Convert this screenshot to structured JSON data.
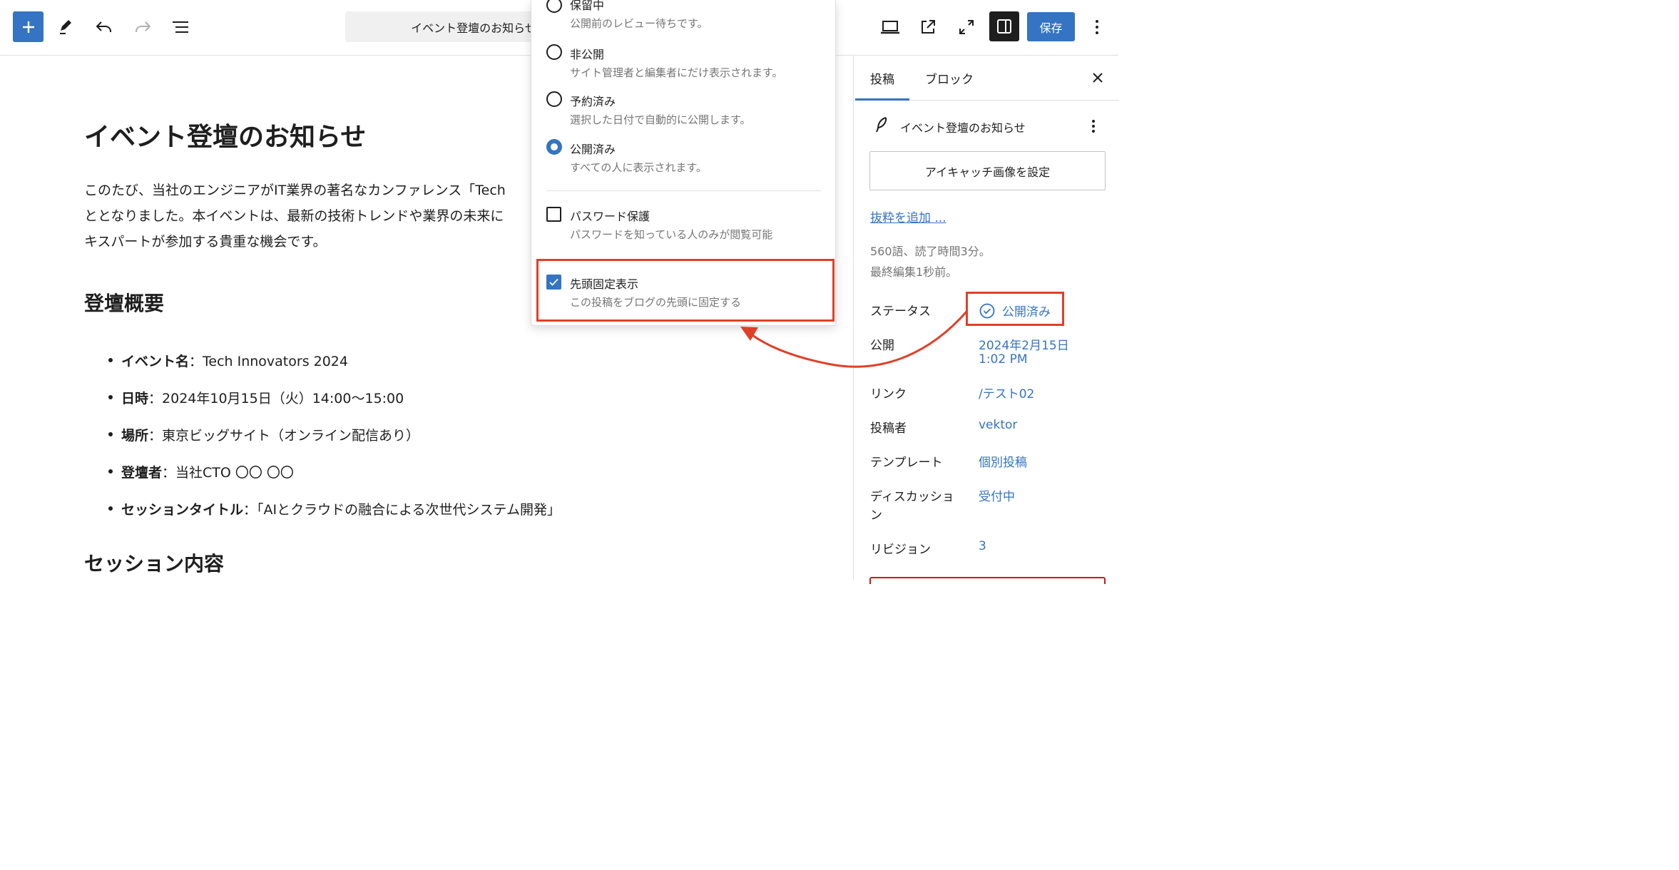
{
  "toolbar": {
    "document_title": "イベント登壇のお知らせ",
    "save_label": "保存",
    "icons": [
      "plus-icon",
      "pencil-icon",
      "undo-icon",
      "redo-icon",
      "list-view-icon",
      "desktop-preview-icon",
      "external-link-icon",
      "fullscreen-icon",
      "sidebar-icon",
      "more-vertical-icon"
    ]
  },
  "editor": {
    "title": "イベント登壇のお知らせ",
    "intro_lines": [
      "このたび、当社のエンジニアがIT業界の著名なカンファレンス「Tech",
      "ととなりました。本イベントは、最新の技術トレンドや業界の未来に",
      "キスパートが参加する貴重な機会です。"
    ],
    "section1_heading": "登壇概要",
    "event_items": [
      {
        "key": "イベント名",
        "value": "：Tech Innovators 2024"
      },
      {
        "key": "日時",
        "value": "：2024年10月15日（火）14:00〜15:00"
      },
      {
        "key": "場所",
        "value": "：東京ビッグサイト（オンライン配信あり）"
      },
      {
        "key": "登壇者",
        "value": "：当社CTO 〇〇 〇〇"
      },
      {
        "key": "セッションタイトル",
        "value": "：「AIとクラウドの融合による次世代システム開発」"
      }
    ],
    "section2_heading": "セッション内容"
  },
  "sidebar": {
    "tab_post": "投稿",
    "tab_block": "ブロック",
    "post_title": "イベント登壇のお知らせ",
    "featured_image_button": "アイキャッチ画像を設定",
    "excerpt_link": "抜粋を追加 ...",
    "word_count": "560語、読了時間3分。",
    "last_edited": "最終編集1秒前。",
    "rows": {
      "status_label": "ステータス",
      "status_value": "公開済み",
      "publish_label": "公開",
      "publish_value_date": "2024年2月15日",
      "publish_value_time": "1:02 PM",
      "link_label": "リンク",
      "link_value": "/テスト02",
      "author_label": "投稿者",
      "author_value": "vektor",
      "template_label": "テンプレート",
      "template_value": "個別投稿",
      "discussion_label_1": "ディスカッショ",
      "discussion_label_2": "ン",
      "discussion_value": "受付中",
      "revisions_label": "リビジョン",
      "revisions_value": "3"
    }
  },
  "status_popover": {
    "options": [
      {
        "label": "保留中",
        "desc": "公開前のレビュー待ちです。",
        "selected": false
      },
      {
        "label": "非公開",
        "desc": "サイト管理者と編集者にだけ表示されます。",
        "selected": false
      },
      {
        "label": "予約済み",
        "desc": "選択した日付で自動的に公開します。",
        "selected": false
      },
      {
        "label": "公開済み",
        "desc": "すべての人に表示されます。",
        "selected": true
      }
    ],
    "password_label": "パスワード保護",
    "password_desc": "パスワードを知っている人のみが閲覧可能",
    "password_checked": false,
    "sticky_label": "先頭固定表示",
    "sticky_desc": "この投稿をブログの先頭に固定する",
    "sticky_checked": true
  },
  "colors": {
    "accent": "#3474c2",
    "annotation": "#e04028",
    "text": "#1e1e1e",
    "muted": "#757575"
  }
}
